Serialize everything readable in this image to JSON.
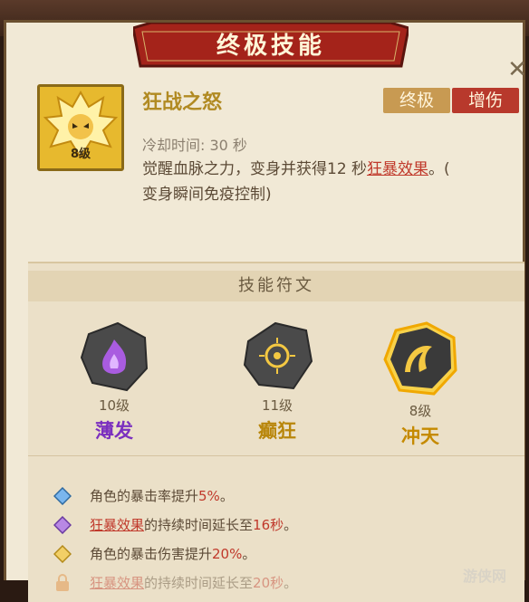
{
  "header": {
    "title": "终极技能"
  },
  "skill": {
    "name": "狂战之怒",
    "level_badge": "8级",
    "tags": [
      "终极",
      "增伤"
    ],
    "cooldown": "冷却时间: 30 秒",
    "desc_part1": "觉醒血脉之力，变身并获得12 秒",
    "desc_link": "狂暴效果",
    "desc_part2": "。(",
    "desc_line2": "变身瞬间免疫控制)"
  },
  "runes": {
    "section_title": "技能符文",
    "items": [
      {
        "level": "10级",
        "name": "薄发",
        "color": "#7b2fbf"
      },
      {
        "level": "11级",
        "name": "癫狂",
        "color": "#b8860b"
      },
      {
        "level": "8级",
        "name": "冲天",
        "color": "#c58a00"
      }
    ]
  },
  "effects": [
    {
      "pre": "角色的暴击率提升",
      "value": "5%",
      "post": "。",
      "icon": "blue-diamond-icon"
    },
    {
      "link": "狂暴效果",
      "pre": "的持续时间延长至",
      "value": "16秒",
      "post": "。",
      "icon": "purple-diamond-icon"
    },
    {
      "pre": "角色的暴击伤害提升",
      "value": "20%",
      "post": "。",
      "icon": "gold-diamond-icon"
    },
    {
      "link": "狂暴效果",
      "pre": "的持续时间延长至",
      "value": "20秒",
      "post": "。",
      "icon": "lock-icon"
    }
  ],
  "watermark": "游侠网"
}
